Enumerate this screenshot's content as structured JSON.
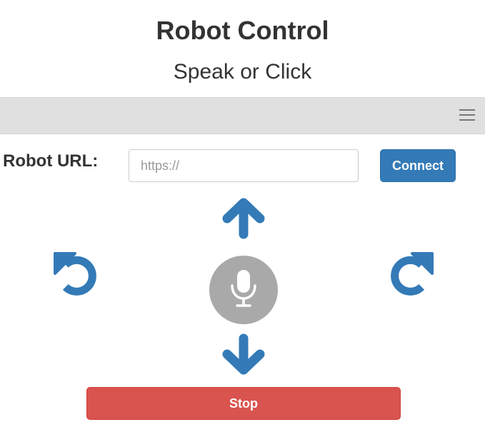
{
  "header": {
    "title": "Robot Control",
    "subtitle": "Speak or Click"
  },
  "navbar": {
    "menu_icon": "hamburger-menu-icon"
  },
  "connection": {
    "label": "Robot URL:",
    "url_value": "",
    "url_placeholder": "https://",
    "connect_label": "Connect"
  },
  "controls": {
    "forward_icon": "arrow-up-icon",
    "backward_icon": "arrow-down-icon",
    "rotate_left_icon": "rotate-left-icon",
    "rotate_right_icon": "rotate-right-icon",
    "voice_icon": "microphone-icon",
    "stop_label": "Stop"
  },
  "colors": {
    "primary": "#337ab7",
    "danger": "#d9534f",
    "mic_background": "#a9a9a9",
    "navbar_background": "#e0e0e0"
  }
}
